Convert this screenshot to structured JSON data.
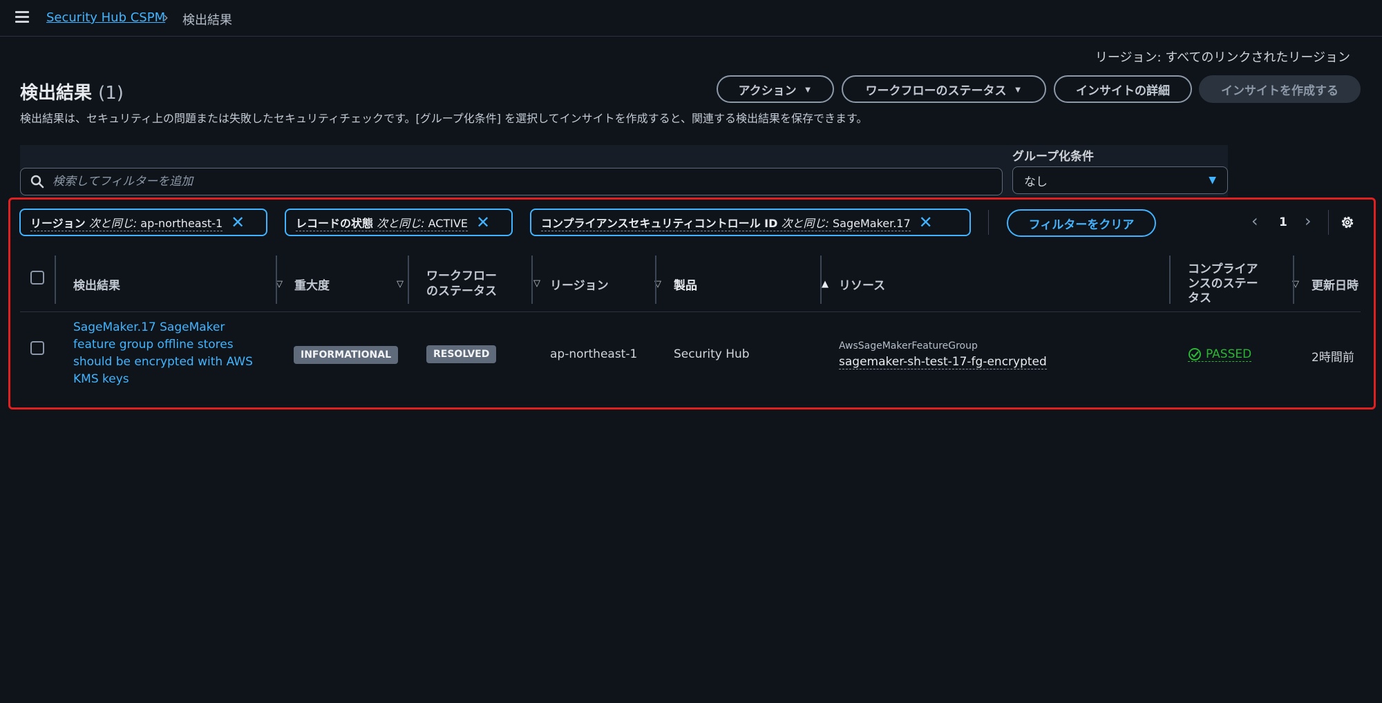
{
  "breadcrumb": {
    "service": "Security Hub CSPM",
    "current": "検出結果"
  },
  "region_selector": "リージョン: すべてのリンクされたリージョン",
  "page": {
    "title": "検出結果",
    "count": "(1)",
    "description": "検出結果は、セキュリティ上の問題または失敗したセキュリティチェックです。[グループ化条件] を選択してインサイトを作成すると、関連する検出結果を保存できます。"
  },
  "actions": {
    "action_label": "アクション",
    "workflow_label": "ワークフローのステータス",
    "insight_details_label": "インサイトの詳細",
    "create_insight_label": "インサイトを作成する"
  },
  "search": {
    "placeholder": "検索してフィルターを追加"
  },
  "group_by": {
    "label": "グループ化条件",
    "selected": "なし"
  },
  "filters": [
    {
      "key": "リージョン",
      "op": "次と同じ:",
      "value": "ap-northeast-1"
    },
    {
      "key": "レコードの状態",
      "op": "次と同じ:",
      "value": "ACTIVE"
    },
    {
      "key": "コンプライアンスセキュリティコントロール ID",
      "op": "次と同じ:",
      "value": "SageMaker.17"
    }
  ],
  "clear_filters_label": "フィルターをクリア",
  "pagination": {
    "current_page": "1"
  },
  "table": {
    "columns": {
      "finding": "検出結果",
      "severity": "重大度",
      "workflow_line1": "ワークフロー",
      "workflow_line2": "のステータス",
      "region": "リージョン",
      "product": "製品",
      "resource": "リソース",
      "compliance_line1": "コンプライア",
      "compliance_line2": "ンスのステー",
      "compliance_line3": "タス",
      "updated": "更新日時"
    },
    "rows": [
      {
        "finding": "SageMaker.17 SageMaker feature group offline stores should be encrypted with AWS KMS keys",
        "severity": "INFORMATIONAL",
        "workflow": "RESOLVED",
        "region": "ap-northeast-1",
        "product": "Security Hub",
        "resource_type": "AwsSageMakerFeatureGroup",
        "resource_id": "sagemaker-sh-test-17-fg-encrypted",
        "compliance": "PASSED",
        "updated": "2時間前"
      }
    ]
  },
  "colors": {
    "accent": "#42b4ff",
    "pass": "#2bb534",
    "highlight": "#e02020",
    "background": "#0f141a"
  }
}
